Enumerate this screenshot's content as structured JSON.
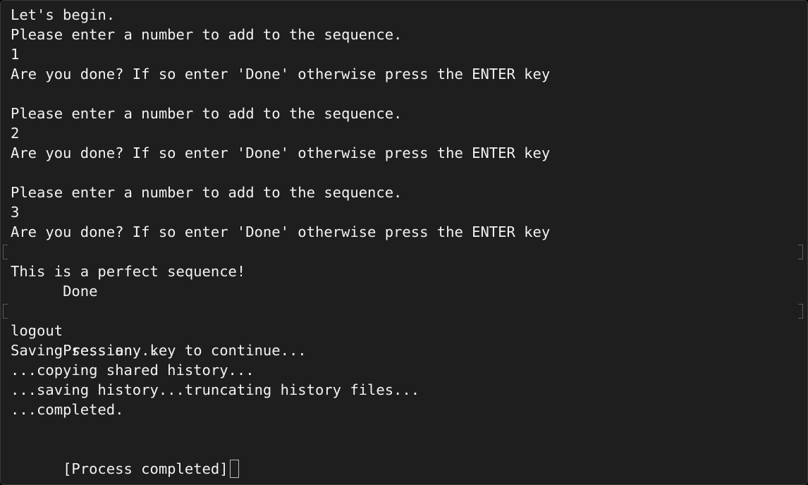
{
  "terminal": {
    "lines": [
      "Let's begin.",
      "Please enter a number to add to the sequence.",
      "1",
      "Are you done? If so enter 'Done' otherwise press the ENTER key",
      "",
      "Please enter a number to add to the sequence.",
      "2",
      "Are you done? If so enter 'Done' otherwise press the ENTER key",
      "",
      "Please enter a number to add to the sequence.",
      "3",
      "Are you done? If so enter 'Done' otherwise press the ENTER key",
      "Done",
      "This is a perfect sequence!",
      "",
      "Press any key to continue...",
      "logout",
      "Saving session...",
      "...copying shared history...",
      "...saving history...truncating history files...",
      "...completed.",
      "",
      "[Process completed]"
    ]
  },
  "colors": {
    "background": "#1e1e1e",
    "text": "#f2f2f2",
    "cursor_outline": "#bdbdbd"
  }
}
